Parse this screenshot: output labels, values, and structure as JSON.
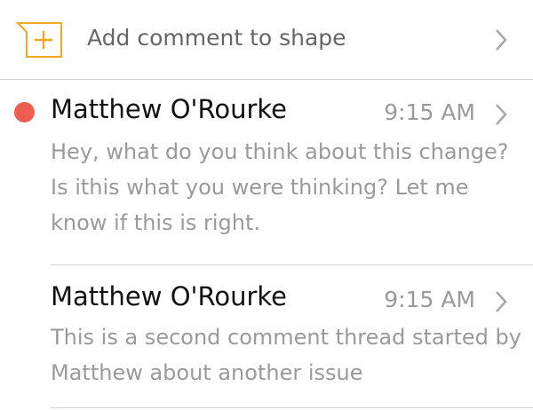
{
  "add_comment": {
    "label": "Add comment to shape",
    "icon": "add-comment-icon",
    "accent_color": "#F5A623"
  },
  "comments": [
    {
      "author": "Matthew O'Rourke",
      "time": "9:15 AM",
      "body": "Hey, what do you think about this change? Is ithis what you were thinking? Let me know if this is right.",
      "unread": true,
      "unread_color": "#EE5D52"
    },
    {
      "author": "Matthew O'Rourke",
      "time": "9:15 AM",
      "body": "This is a second comment thread started by Matthew about another issue",
      "unread": false
    }
  ]
}
